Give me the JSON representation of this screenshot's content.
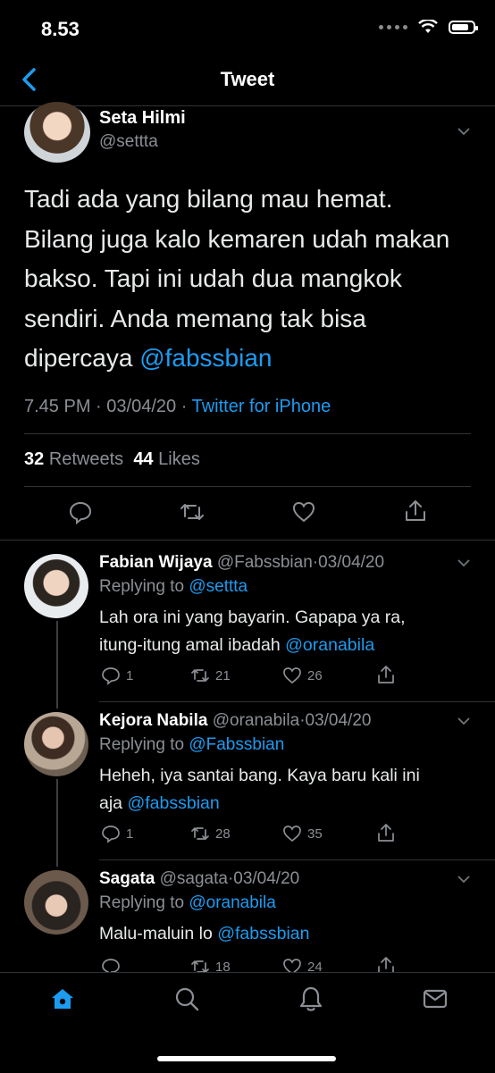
{
  "status_bar": {
    "time": "8.53"
  },
  "nav": {
    "title": "Tweet"
  },
  "tweet": {
    "author_name": "Seta Hilmi",
    "author_handle": "@settta",
    "text_lines": [
      "Tadi ada yang bilang mau hemat.",
      "Bilang juga kalo kemaren udah makan",
      "bakso. Tapi ini udah dua mangkok",
      "sendiri. Anda memang tak bisa",
      "dipercaya "
    ],
    "mention": "@fabssbian",
    "time": "7.45 PM",
    "date": "03/04/20",
    "separator": "·",
    "client": "Twitter for iPhone",
    "retweets_count": "32",
    "retweets_label": "Retweets",
    "likes_count": "44",
    "likes_label": "Likes"
  },
  "replies": [
    {
      "name": "Fabian Wijaya",
      "handle": "@Fabssbian",
      "date": "03/04/20",
      "replying_label": "Replying to ",
      "replying_to": "@settta",
      "text_lines": [
        "Lah ora ini yang bayarin. Gapapa ya ra,",
        "itung-itung amal ibadah "
      ],
      "mention": "@oranabila",
      "replies": "1",
      "retweets": "21",
      "likes": "26"
    },
    {
      "name": "Kejora Nabila",
      "handle": "@oranabila",
      "date": "03/04/20",
      "replying_label": "Replying to ",
      "replying_to": "@Fabssbian",
      "text_lines": [
        "Heheh, iya santai bang. Kaya baru kali ini",
        "aja "
      ],
      "mention": "@fabssbian",
      "replies": "1",
      "retweets": "28",
      "likes": "35"
    },
    {
      "name": "Sagata",
      "handle": "@sagata",
      "date": "03/04/20",
      "replying_label": "Replying to ",
      "replying_to": "@oranabila",
      "text_lines": [
        "Malu-maluin lo "
      ],
      "mention": "@fabssbian",
      "replies": "",
      "retweets": "18",
      "likes": "24"
    }
  ],
  "tabbar": {
    "items": [
      "home-icon",
      "search-icon",
      "notifications-icon",
      "messages-icon"
    ]
  },
  "colors": {
    "accent": "#1d9bf0",
    "background": "#000000",
    "muted": "#8b8f95"
  }
}
